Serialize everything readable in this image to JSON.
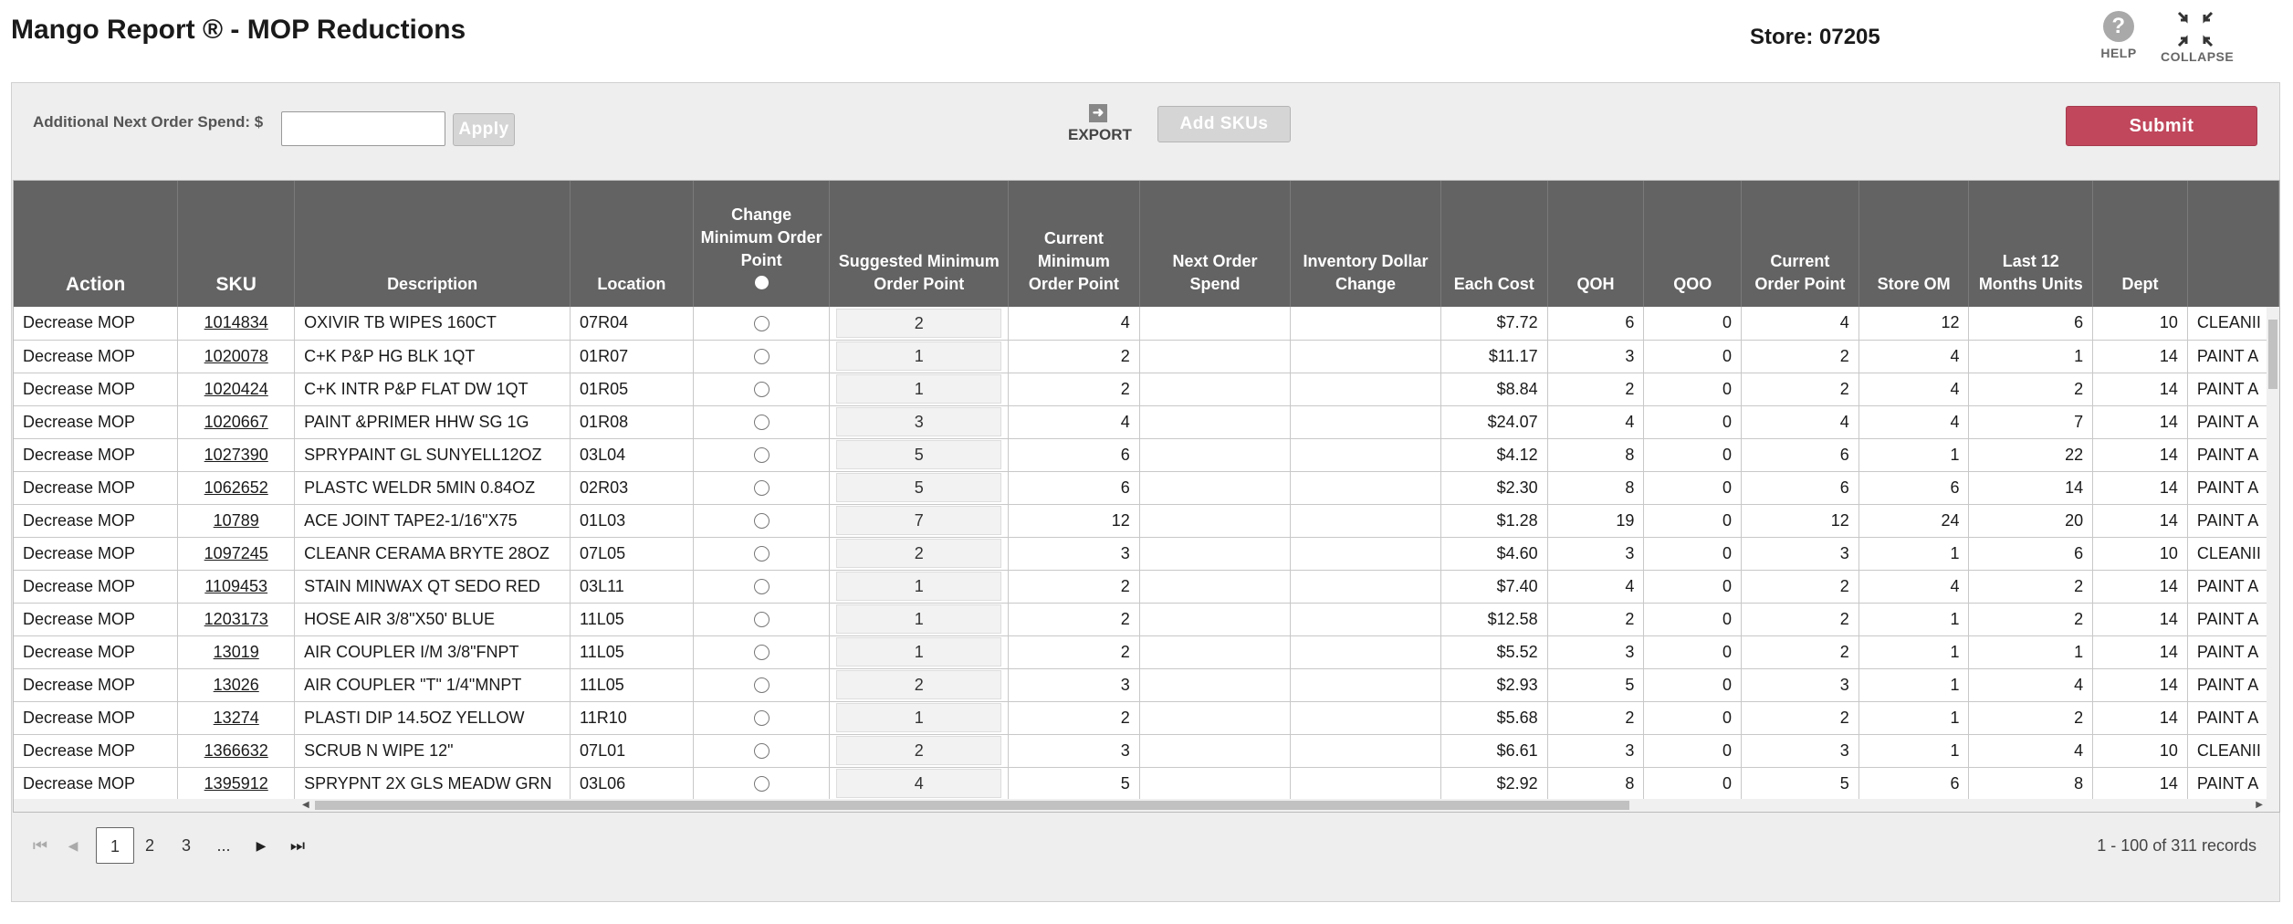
{
  "page": {
    "title": "Mango Report ® - MOP Reductions",
    "store": "Store: 07205"
  },
  "top_buttons": {
    "help_label": "HELP",
    "help_glyph": "?",
    "collapse_label": "COLLAPSE"
  },
  "toolbar": {
    "spend_label": "Additional Next Order Spend: $",
    "spend_value": "",
    "apply_label": "Apply",
    "export_label": "EXPORT",
    "add_skus_label": "Add SKUs",
    "submit_label": "Submit",
    "submit_color": "#c0475c"
  },
  "columns": [
    "Action",
    "SKU",
    "Description",
    "Location",
    "Change Minimum Order Point",
    "Suggested Minimum Order Point",
    "Current Minimum Order Point",
    "Next Order Spend",
    "Inventory Dollar Change",
    "Each Cost",
    "QOH",
    "QOO",
    "Current Order Point",
    "Store OM",
    "Last 12 Months Units",
    "Dept",
    ""
  ],
  "rows": [
    {
      "action": "Decrease MOP",
      "sku": "1014834",
      "desc": "OXIVIR TB WIPES 160CT",
      "loc": "07R04",
      "sugg": "2",
      "cur_mop": "4",
      "next": "",
      "inv": "",
      "cost": "$7.72",
      "qoh": "6",
      "qoo": "0",
      "cop": "4",
      "om": "12",
      "l12": "6",
      "dept": "10",
      "cat": "CLEANII"
    },
    {
      "action": "Decrease MOP",
      "sku": "1020078",
      "desc": "C+K P&P HG BLK 1QT",
      "loc": "01R07",
      "sugg": "1",
      "cur_mop": "2",
      "next": "",
      "inv": "",
      "cost": "$11.17",
      "qoh": "3",
      "qoo": "0",
      "cop": "2",
      "om": "4",
      "l12": "1",
      "dept": "14",
      "cat": "PAINT A"
    },
    {
      "action": "Decrease MOP",
      "sku": "1020424",
      "desc": "C+K INTR P&P FLAT DW 1QT",
      "loc": "01R05",
      "sugg": "1",
      "cur_mop": "2",
      "next": "",
      "inv": "",
      "cost": "$8.84",
      "qoh": "2",
      "qoo": "0",
      "cop": "2",
      "om": "4",
      "l12": "2",
      "dept": "14",
      "cat": "PAINT A"
    },
    {
      "action": "Decrease MOP",
      "sku": "1020667",
      "desc": "PAINT &PRIMER HHW SG 1G",
      "loc": "01R08",
      "sugg": "3",
      "cur_mop": "4",
      "next": "",
      "inv": "",
      "cost": "$24.07",
      "qoh": "4",
      "qoo": "0",
      "cop": "4",
      "om": "4",
      "l12": "7",
      "dept": "14",
      "cat": "PAINT A"
    },
    {
      "action": "Decrease MOP",
      "sku": "1027390",
      "desc": "SPRYPAINT GL SUNYELL12OZ",
      "loc": "03L04",
      "sugg": "5",
      "cur_mop": "6",
      "next": "",
      "inv": "",
      "cost": "$4.12",
      "qoh": "8",
      "qoo": "0",
      "cop": "6",
      "om": "1",
      "l12": "22",
      "dept": "14",
      "cat": "PAINT A"
    },
    {
      "action": "Decrease MOP",
      "sku": "1062652",
      "desc": "PLASTC WELDR 5MIN 0.84OZ",
      "loc": "02R03",
      "sugg": "5",
      "cur_mop": "6",
      "next": "",
      "inv": "",
      "cost": "$2.30",
      "qoh": "8",
      "qoo": "0",
      "cop": "6",
      "om": "6",
      "l12": "14",
      "dept": "14",
      "cat": "PAINT A"
    },
    {
      "action": "Decrease MOP",
      "sku": "10789",
      "desc": "ACE JOINT TAPE2-1/16\"X75",
      "loc": "01L03",
      "sugg": "7",
      "cur_mop": "12",
      "next": "",
      "inv": "",
      "cost": "$1.28",
      "qoh": "19",
      "qoo": "0",
      "cop": "12",
      "om": "24",
      "l12": "20",
      "dept": "14",
      "cat": "PAINT A"
    },
    {
      "action": "Decrease MOP",
      "sku": "1097245",
      "desc": "CLEANR CERAMA BRYTE 28OZ",
      "loc": "07L05",
      "sugg": "2",
      "cur_mop": "3",
      "next": "",
      "inv": "",
      "cost": "$4.60",
      "qoh": "3",
      "qoo": "0",
      "cop": "3",
      "om": "1",
      "l12": "6",
      "dept": "10",
      "cat": "CLEANII"
    },
    {
      "action": "Decrease MOP",
      "sku": "1109453",
      "desc": "STAIN MINWAX QT SEDO RED",
      "loc": "03L11",
      "sugg": "1",
      "cur_mop": "2",
      "next": "",
      "inv": "",
      "cost": "$7.40",
      "qoh": "4",
      "qoo": "0",
      "cop": "2",
      "om": "4",
      "l12": "2",
      "dept": "14",
      "cat": "PAINT A"
    },
    {
      "action": "Decrease MOP",
      "sku": "1203173",
      "desc": "HOSE AIR 3/8\"X50' BLUE",
      "loc": "11L05",
      "sugg": "1",
      "cur_mop": "2",
      "next": "",
      "inv": "",
      "cost": "$12.58",
      "qoh": "2",
      "qoo": "0",
      "cop": "2",
      "om": "1",
      "l12": "2",
      "dept": "14",
      "cat": "PAINT A"
    },
    {
      "action": "Decrease MOP",
      "sku": "13019",
      "desc": "AIR COUPLER I/M 3/8\"FNPT",
      "loc": "11L05",
      "sugg": "1",
      "cur_mop": "2",
      "next": "",
      "inv": "",
      "cost": "$5.52",
      "qoh": "3",
      "qoo": "0",
      "cop": "2",
      "om": "1",
      "l12": "1",
      "dept": "14",
      "cat": "PAINT A"
    },
    {
      "action": "Decrease MOP",
      "sku": "13026",
      "desc": "AIR COUPLER \"T\" 1/4\"MNPT",
      "loc": "11L05",
      "sugg": "2",
      "cur_mop": "3",
      "next": "",
      "inv": "",
      "cost": "$2.93",
      "qoh": "5",
      "qoo": "0",
      "cop": "3",
      "om": "1",
      "l12": "4",
      "dept": "14",
      "cat": "PAINT A"
    },
    {
      "action": "Decrease MOP",
      "sku": "13274",
      "desc": "PLASTI DIP 14.5OZ YELLOW",
      "loc": "11R10",
      "sugg": "1",
      "cur_mop": "2",
      "next": "",
      "inv": "",
      "cost": "$5.68",
      "qoh": "2",
      "qoo": "0",
      "cop": "2",
      "om": "1",
      "l12": "2",
      "dept": "14",
      "cat": "PAINT A"
    },
    {
      "action": "Decrease MOP",
      "sku": "1366632",
      "desc": "SCRUB N WIPE 12\"",
      "loc": "07L01",
      "sugg": "2",
      "cur_mop": "3",
      "next": "",
      "inv": "",
      "cost": "$6.61",
      "qoh": "3",
      "qoo": "0",
      "cop": "3",
      "om": "1",
      "l12": "4",
      "dept": "10",
      "cat": "CLEANII"
    },
    {
      "action": "Decrease MOP",
      "sku": "1395912",
      "desc": "SPRYPNT 2X GLS MEADW GRN",
      "loc": "03L06",
      "sugg": "4",
      "cur_mop": "5",
      "next": "",
      "inv": "",
      "cost": "$2.92",
      "qoh": "8",
      "qoo": "0",
      "cop": "5",
      "om": "6",
      "l12": "8",
      "dept": "14",
      "cat": "PAINT A"
    }
  ],
  "pager": {
    "pages": [
      "1",
      "2",
      "3",
      "..."
    ],
    "current": "1",
    "records": "1 - 100 of 311 records"
  }
}
